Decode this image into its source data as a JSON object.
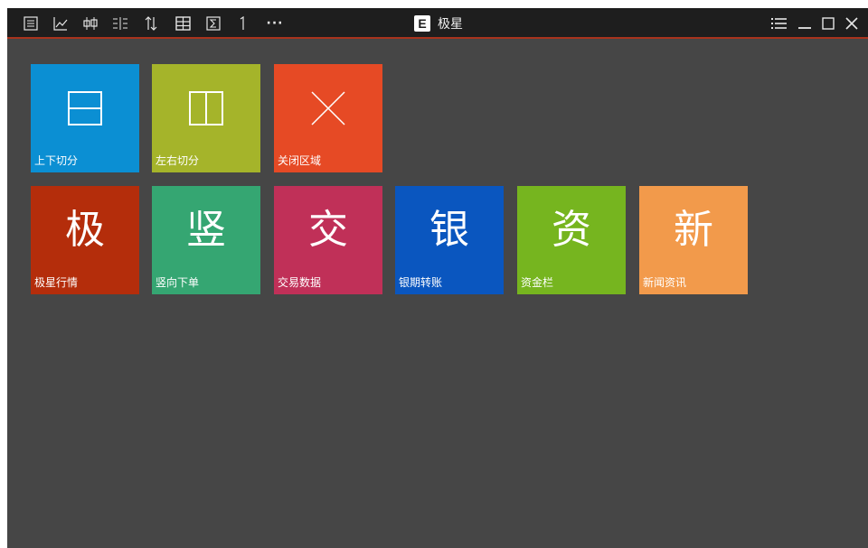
{
  "app": {
    "title": "极星",
    "logo_letter": "E"
  },
  "toolbar": {
    "icons": [
      "list-icon",
      "line-chart-icon",
      "candlestick-icon",
      "depth-icon",
      "sort-icon",
      "table-icon",
      "formula-icon",
      "one-icon",
      "more-icon"
    ],
    "more_label": "···"
  },
  "window_controls": [
    "menu-icon",
    "minimize-icon",
    "maximize-icon",
    "close-icon"
  ],
  "tiles": [
    {
      "label": "上下切分",
      "icon": "split-horizontal-icon",
      "color": "#0b8fd3"
    },
    {
      "label": "左右切分",
      "icon": "split-vertical-icon",
      "color": "#a5b42a"
    },
    {
      "label": "关闭区域",
      "icon": "close-area-icon",
      "color": "#e64a25"
    },
    {
      "label": "极星行情",
      "char": "极",
      "color": "#b42d0b"
    },
    {
      "label": "竖向下单",
      "char": "竖",
      "color": "#35a672"
    },
    {
      "label": "交易数据",
      "char": "交",
      "color": "#c03058"
    },
    {
      "label": "银期转账",
      "char": "银",
      "color": "#0a56bf"
    },
    {
      "label": "资金栏",
      "char": "资",
      "color": "#76b51f"
    },
    {
      "label": "新闻资讯",
      "char": "新",
      "color": "#f29a4b"
    }
  ],
  "colors": {
    "background": "#464646",
    "titlebar": "#1e1e1e",
    "titlebar_border": "#a8331d"
  }
}
